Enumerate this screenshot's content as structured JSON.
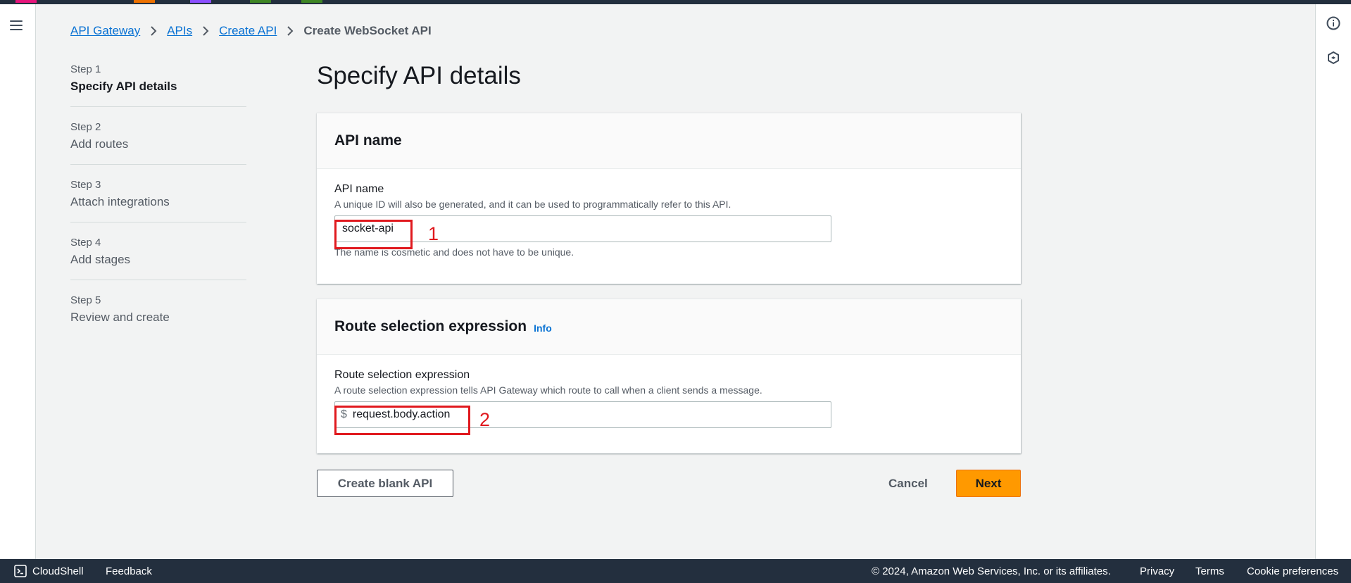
{
  "breadcrumb": {
    "items": [
      "API Gateway",
      "APIs",
      "Create API"
    ],
    "current": "Create WebSocket API"
  },
  "steps": [
    {
      "num": "Step 1",
      "label": "Specify API details",
      "active": true
    },
    {
      "num": "Step 2",
      "label": "Add routes",
      "active": false
    },
    {
      "num": "Step 3",
      "label": "Attach integrations",
      "active": false
    },
    {
      "num": "Step 4",
      "label": "Add stages",
      "active": false
    },
    {
      "num": "Step 5",
      "label": "Review and create",
      "active": false
    }
  ],
  "page_title": "Specify API details",
  "api_name_panel": {
    "header": "API name",
    "label": "API name",
    "description": "A unique ID will also be generated, and it can be used to programmatically refer to this API.",
    "value": "socket-api",
    "hint": "The name is cosmetic and does not have to be unique.",
    "annotation": "1"
  },
  "route_panel": {
    "header": "Route selection expression",
    "info": "Info",
    "label": "Route selection expression",
    "description": "A route selection expression tells API Gateway which route to call when a client sends a message.",
    "prefix": "$",
    "value": "request.body.action",
    "annotation": "2"
  },
  "actions": {
    "create_blank": "Create blank API",
    "cancel": "Cancel",
    "next": "Next"
  },
  "footer": {
    "cloudshell": "CloudShell",
    "feedback": "Feedback",
    "copyright": "© 2024, Amazon Web Services, Inc. or its affiliates.",
    "privacy": "Privacy",
    "terms": "Terms",
    "cookies": "Cookie preferences"
  },
  "colors": {
    "link": "#0972d3",
    "primary_button": "#ff9900",
    "annotation": "#e0191e",
    "nav_dark": "#232f3e"
  }
}
